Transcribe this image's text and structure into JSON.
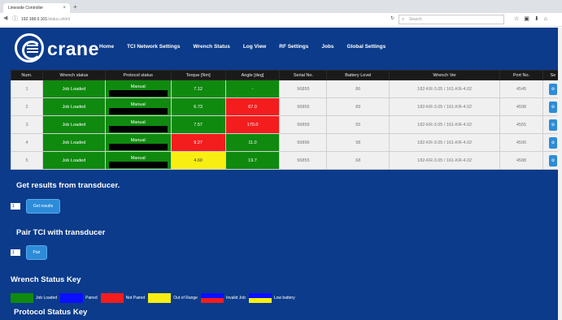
{
  "browser": {
    "tab_title": "Limeside Controller",
    "tab_close": "×",
    "new_tab": "+",
    "url_host": "192.168.0.101",
    "url_path": "/status.shtml",
    "search_placeholder": "Search"
  },
  "logo": {
    "text": "crane"
  },
  "nav": [
    "Home",
    "TCI Network Settings",
    "Wrench Status",
    "Log View",
    "RF Settings",
    "Jobs",
    "Global Settings"
  ],
  "table": {
    "headers": [
      "Num.",
      "Wrench status",
      "Protocol status",
      "Torque [Nm]",
      "Angle [deg]",
      "Serial No.",
      "Battery Level",
      "Wrench Ver",
      "Port No.",
      "Se"
    ],
    "rows": [
      {
        "num": "1",
        "status": "Job Loaded",
        "protocol": "Manual",
        "torque": "7.12",
        "angle": "-",
        "serial": "96855",
        "battery": "86",
        "ver": "182-KR-3.05 / 161-KR-4.02",
        "port": "4545"
      },
      {
        "num": "2",
        "status": "Job Loaded",
        "protocol": "Manual",
        "torque": "6.73",
        "angle": "67.0",
        "serial": "96856",
        "battery": "89",
        "ver": "182-KR-3.05 / 161-KR-4.02",
        "port": "4598"
      },
      {
        "num": "3",
        "status": "Job Loaded",
        "protocol": "Manual",
        "torque": "7.57",
        "angle": "170.0",
        "serial": "96859",
        "battery": "65",
        "ver": "182-KR-3.05 / 161-KR-4.02",
        "port": "4555"
      },
      {
        "num": "4",
        "status": "Job Loaded",
        "protocol": "Manual",
        "torque": "9.27",
        "angle": "11.0",
        "serial": "96896",
        "battery": "98",
        "ver": "182-KR-3.05 / 161-KR-4.02",
        "port": "4590"
      },
      {
        "num": "5",
        "status": "Job Loaded",
        "protocol": "Manual",
        "torque": "4.60",
        "angle": "19.7",
        "serial": "96855",
        "battery": "68",
        "ver": "182-KR-3.05 / 161-KR-4.02",
        "port": "4588"
      }
    ],
    "settings_glyph": "⚙"
  },
  "get_results": {
    "title": "Get results from transducer.",
    "select_value": "1",
    "button": "Get results"
  },
  "pair": {
    "title": "Pair TCI with transducer",
    "select_value": "1",
    "button": "Pair"
  },
  "wrench_key": {
    "title": "Wrench Status Key",
    "items": [
      "Job Loaded",
      "Paired",
      "Not Paired",
      "Out of Range",
      "Invalid Job",
      "Low battery"
    ]
  },
  "protocol_key": {
    "title": "Protocol Status Key"
  },
  "colors": {
    "page_bg": "#0b3b8a",
    "green": "#0f8a0f",
    "red": "#f31d1d",
    "yellow": "#f9ee12",
    "blue": "#0a10ff",
    "button": "#2d8cd9"
  }
}
